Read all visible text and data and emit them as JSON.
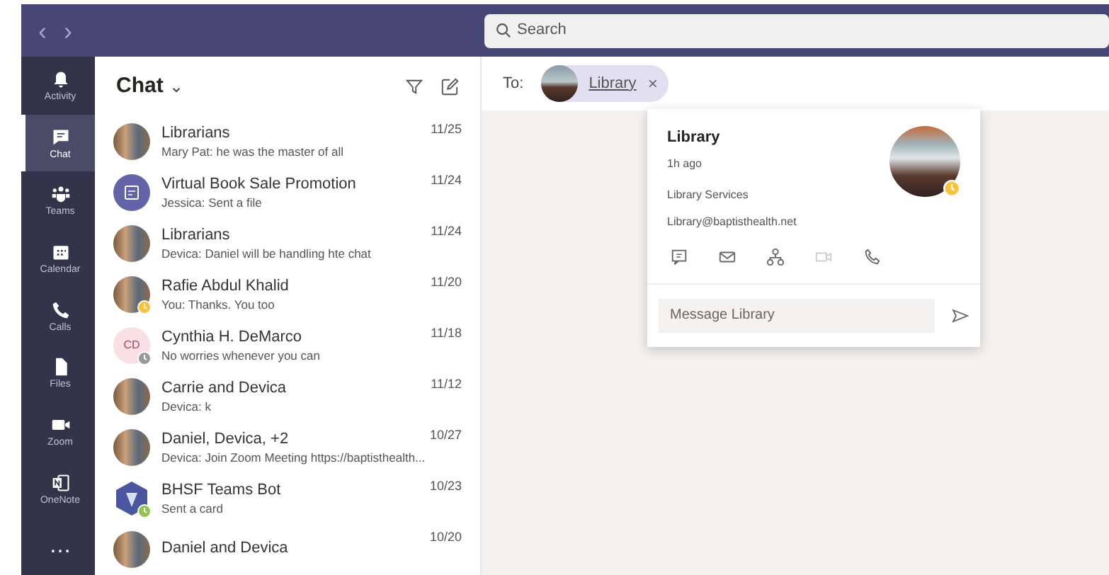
{
  "nav": {
    "back": "‹",
    "forward": "›"
  },
  "search": {
    "placeholder": "Search"
  },
  "rail": [
    {
      "label": "Activity",
      "selected": false
    },
    {
      "label": "Chat",
      "selected": true
    },
    {
      "label": "Teams",
      "selected": false
    },
    {
      "label": "Calendar",
      "selected": false
    },
    {
      "label": "Calls",
      "selected": false
    },
    {
      "label": "Files",
      "selected": false
    },
    {
      "label": "Zoom",
      "selected": false
    },
    {
      "label": "OneNote",
      "selected": false
    },
    {
      "label": "…",
      "selected": false
    }
  ],
  "chat_list": {
    "title": "Chat",
    "chevron": "⌄"
  },
  "chats": [
    {
      "kind": "photo",
      "name": "Librarians",
      "preview": "Mary Pat: he was the master of all",
      "date": "11/25"
    },
    {
      "kind": "icon",
      "name": "Virtual Book Sale Promotion",
      "preview": "Jessica: Sent a file",
      "date": "11/24"
    },
    {
      "kind": "photo",
      "name": "Librarians",
      "preview": "Devica: Daniel will be handling hte chat",
      "date": "11/24"
    },
    {
      "kind": "photo",
      "name": "Rafie Abdul Khalid",
      "preview": "You: Thanks. You too",
      "date": "11/20",
      "color": "#f8c23b"
    },
    {
      "kind": "initials",
      "initials": "CD",
      "name": "Cynthia H. DeMarco",
      "preview": "No worries whenever you can",
      "date": "11/18",
      "color": "#999999"
    },
    {
      "kind": "photo",
      "name": "Carrie and Devica",
      "preview": "Devica: k",
      "date": "11/12"
    },
    {
      "kind": "photo",
      "name": "Daniel, Devica, +2",
      "preview": "Devica: Join Zoom Meeting https://baptisthealth...",
      "date": "10/27"
    },
    {
      "kind": "bot",
      "name": "BHSF Teams Bot",
      "preview": "Sent a card",
      "date": "10/23",
      "color": "#92c353"
    },
    {
      "kind": "photo",
      "name": "Daniel and Devica",
      "date": "10/20"
    }
  ],
  "to": {
    "label": "To:",
    "recipient": "Library",
    "remove": "×"
  },
  "contact_card": {
    "name": "Library",
    "last_seen": "1h ago",
    "department": "Library Services",
    "email": "Library@baptisthealth.net",
    "actions": [
      {
        "disabled": false
      },
      {
        "disabled": false
      },
      {
        "disabled": false
      },
      {
        "disabled": true
      },
      {
        "disabled": false
      }
    ],
    "message_placeholder": "Message Library"
  }
}
